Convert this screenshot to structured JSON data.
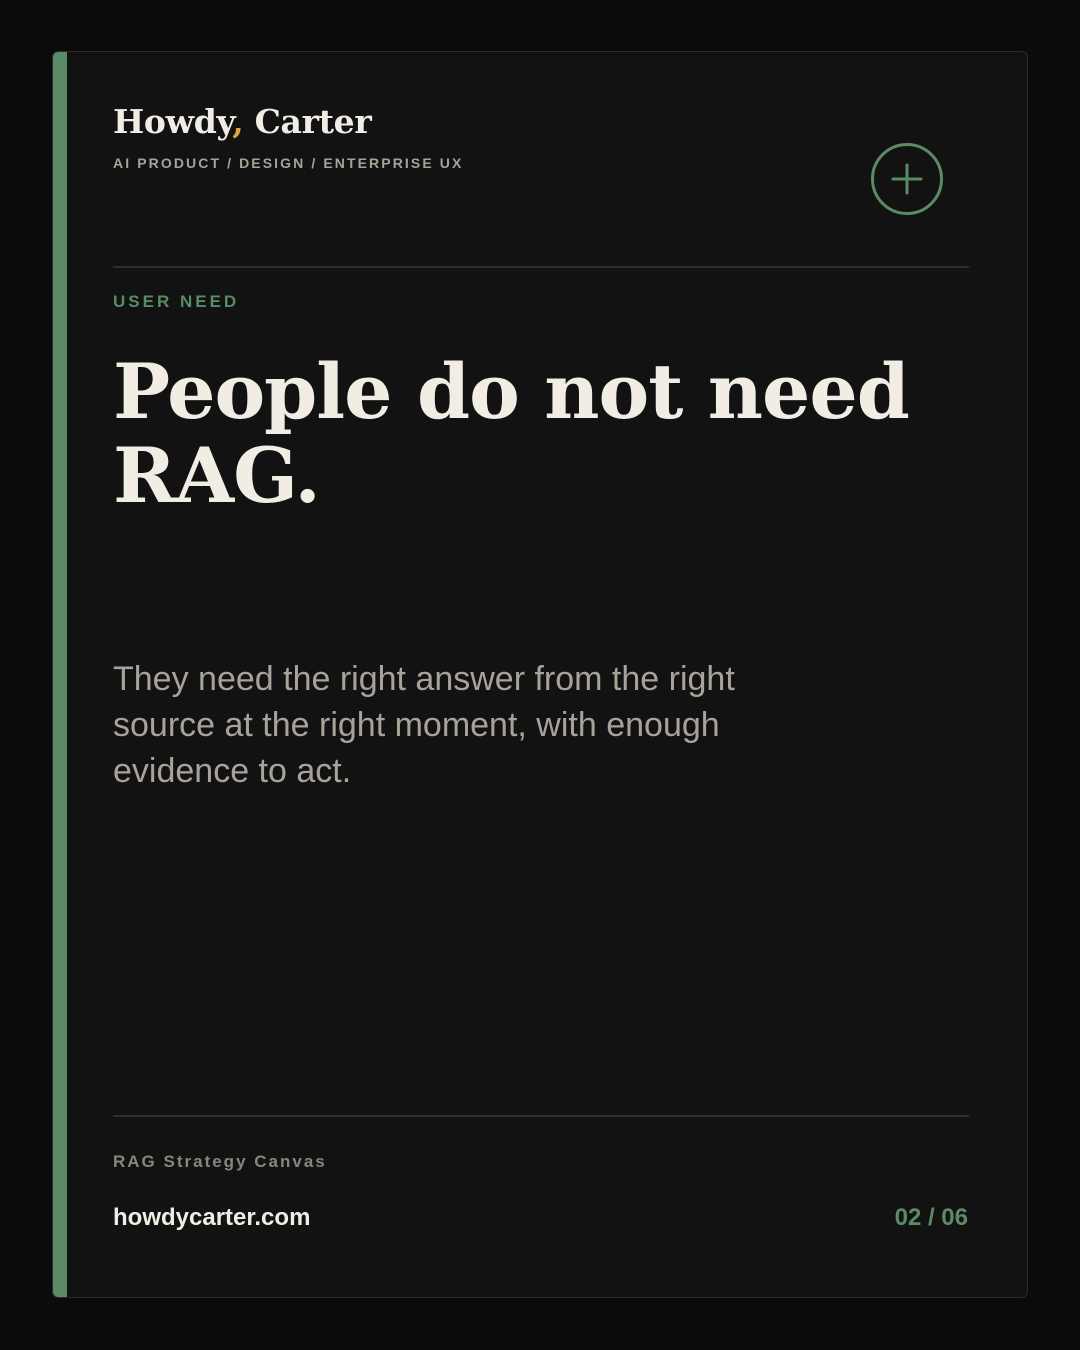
{
  "brand": {
    "name_first": "Howdy",
    "comma": ",",
    "name_last": " Carter",
    "tagline": "AI PRODUCT / DESIGN / ENTERPRISE UX"
  },
  "header": {
    "action_icon": "plus-circle-icon"
  },
  "section": {
    "label": "USER NEED",
    "headline": "People do not need RAG.",
    "body": "They need the right answer from the right source at the right moment, with enough evidence to act."
  },
  "footer": {
    "label": "RAG Strategy Canvas",
    "url": "howdycarter.com",
    "page": "02 / 06"
  },
  "colors": {
    "background": "#0b0b0b",
    "card": "#121212",
    "accent": "#5a8a66",
    "comma_accent": "#d9a441",
    "text_primary": "#f2ede4",
    "text_secondary": "#a8a298"
  }
}
